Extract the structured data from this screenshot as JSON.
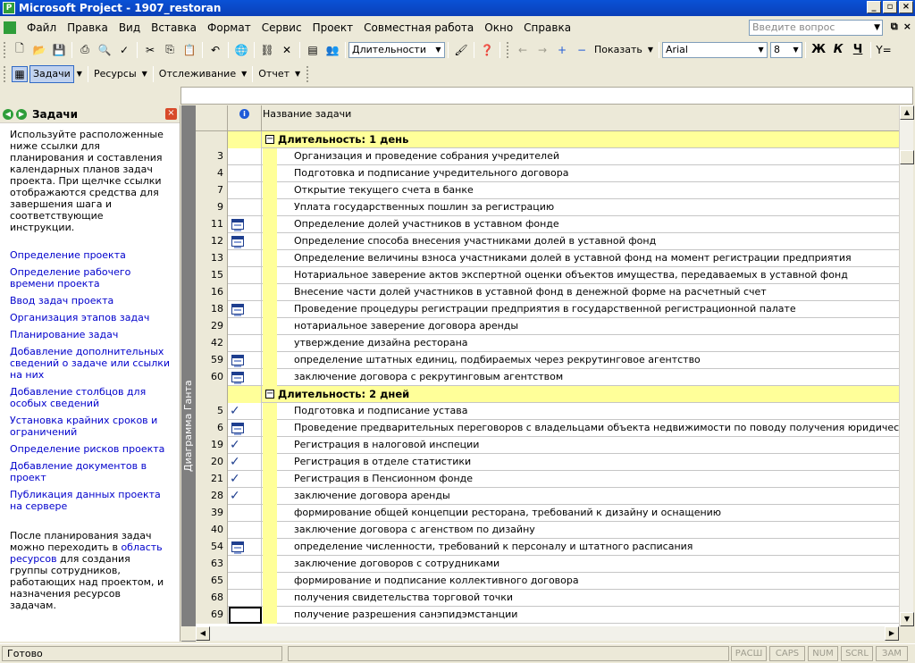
{
  "window": {
    "title": "Microsoft Project - 1907_restoran"
  },
  "menu": [
    {
      "label": "Файл"
    },
    {
      "label": "Правка"
    },
    {
      "label": "Вид"
    },
    {
      "label": "Вставка"
    },
    {
      "label": "Формат"
    },
    {
      "label": "Сервис"
    },
    {
      "label": "Проект"
    },
    {
      "label": "Совместная работа"
    },
    {
      "label": "Окно"
    },
    {
      "label": "Справка"
    }
  ],
  "help_search": {
    "placeholder": "Введите вопрос"
  },
  "toolbar1": {
    "group_by": "Длительности",
    "show_label": "Показать",
    "font": "Arial",
    "font_size": "8",
    "bold": "Ж",
    "italic": "К",
    "underline": "Ч"
  },
  "toolbar2": {
    "tasks": "Задачи",
    "resources": "Ресурсы",
    "tracking": "Отслеживание",
    "report": "Отчет"
  },
  "taskpane": {
    "title": "Задачи",
    "intro": "Используйте расположенные ниже ссылки для планирования и составления календарных планов задач проекта. При щелчке ссылки отображаются средства для завершения шага и соответствующие инструкции.",
    "links": [
      "Определение проекта",
      "Определение рабочего времени проекта",
      "Ввод задач проекта",
      "Организация этапов задач",
      "Планирование задач",
      "Добавление дополнительных сведений о задаче или ссылки на них",
      "Добавление столбцов для особых сведений",
      "Установка крайних сроков и ограничений",
      "Определение рисков проекта",
      "Добавление документов в проект",
      "Публикация данных проекта на сервере"
    ],
    "outro_before": "После планирования задач можно переходить в ",
    "outro_link": "область ресурсов",
    "outro_after": " для создания группы сотрудников, работающих над проектом, и назначения ресурсов задачам."
  },
  "view_label": "Диаграмма Ганта",
  "table": {
    "col_name": "Название задачи",
    "rows": [
      {
        "type": "group",
        "name": "Длительность: 1 день"
      },
      {
        "id": "3",
        "ind": "",
        "name": "Организация и проведение собрания учредителей"
      },
      {
        "id": "4",
        "ind": "",
        "name": "Подготовка и подписание учредительного договора"
      },
      {
        "id": "7",
        "ind": "",
        "name": "Открытие текущего счета в банке"
      },
      {
        "id": "9",
        "ind": "",
        "name": "Уплата государственных пошлин за регистрацию"
      },
      {
        "id": "11",
        "ind": "calendar",
        "name": "Определение долей участников в уставном фонде"
      },
      {
        "id": "12",
        "ind": "calendar",
        "name": "Определение способа внесения участниками долей в уставной фонд"
      },
      {
        "id": "13",
        "ind": "",
        "name": "Определение величины взноса участниками долей в уставной фонд на момент регистрации предприятия"
      },
      {
        "id": "15",
        "ind": "",
        "name": "Нотариальное заверение актов экспертной оценки объектов имущества, передаваемых в уставной фонд"
      },
      {
        "id": "16",
        "ind": "",
        "name": "Внесение части долей участников в уставной фонд в денежной форме на расчетный счет"
      },
      {
        "id": "18",
        "ind": "calendar",
        "name": "Проведение процедуры регистрации предприятия в государственной регистрационной палате"
      },
      {
        "id": "29",
        "ind": "",
        "name": "нотариальное заверение договора аренды"
      },
      {
        "id": "42",
        "ind": "",
        "name": "утверждение дизайна ресторана"
      },
      {
        "id": "59",
        "ind": "calendar",
        "name": "определение штатных единиц, подбираемых через рекрутинговое агентство"
      },
      {
        "id": "60",
        "ind": "calendar",
        "name": "заключение договора с рекрутинговым агентством"
      },
      {
        "type": "group",
        "name": "Длительность: 2 дней"
      },
      {
        "id": "5",
        "ind": "check",
        "name": "Подготовка и подписание устава"
      },
      {
        "id": "6",
        "ind": "calendar",
        "name": "Проведение предварительных переговоров с владельцами объекта недвижимости по поводу получения юридического адреса"
      },
      {
        "id": "19",
        "ind": "check",
        "name": "Регистрация в налоговой инспеции"
      },
      {
        "id": "20",
        "ind": "check",
        "name": "Регистрация в отделе статистики"
      },
      {
        "id": "21",
        "ind": "check",
        "name": "Регистрация в Пенсионном фонде"
      },
      {
        "id": "28",
        "ind": "check",
        "name": "заключение договора аренды"
      },
      {
        "id": "39",
        "ind": "",
        "name": "формирование общей концепции ресторана, требований к дизайну и оснащению"
      },
      {
        "id": "40",
        "ind": "",
        "name": "заключение договора с агенством по дизайну"
      },
      {
        "id": "54",
        "ind": "calendar",
        "name": "определение численности, требований к персоналу и штатного расписания"
      },
      {
        "id": "63",
        "ind": "",
        "name": "заключение договоров с сотрудниками"
      },
      {
        "id": "65",
        "ind": "",
        "name": "формирование и подписание коллективного договора"
      },
      {
        "id": "68",
        "ind": "",
        "name": "получения свидетельства торговой точки"
      },
      {
        "id": "69",
        "ind": "selected",
        "name": "получение разрешения санэпидэмстанции"
      }
    ]
  },
  "status": {
    "ready": "Готово",
    "ext": "РАСШ",
    "caps": "CAPS",
    "num": "NUM",
    "scrl": "SCRL",
    "ovr": "ЗАМ"
  }
}
